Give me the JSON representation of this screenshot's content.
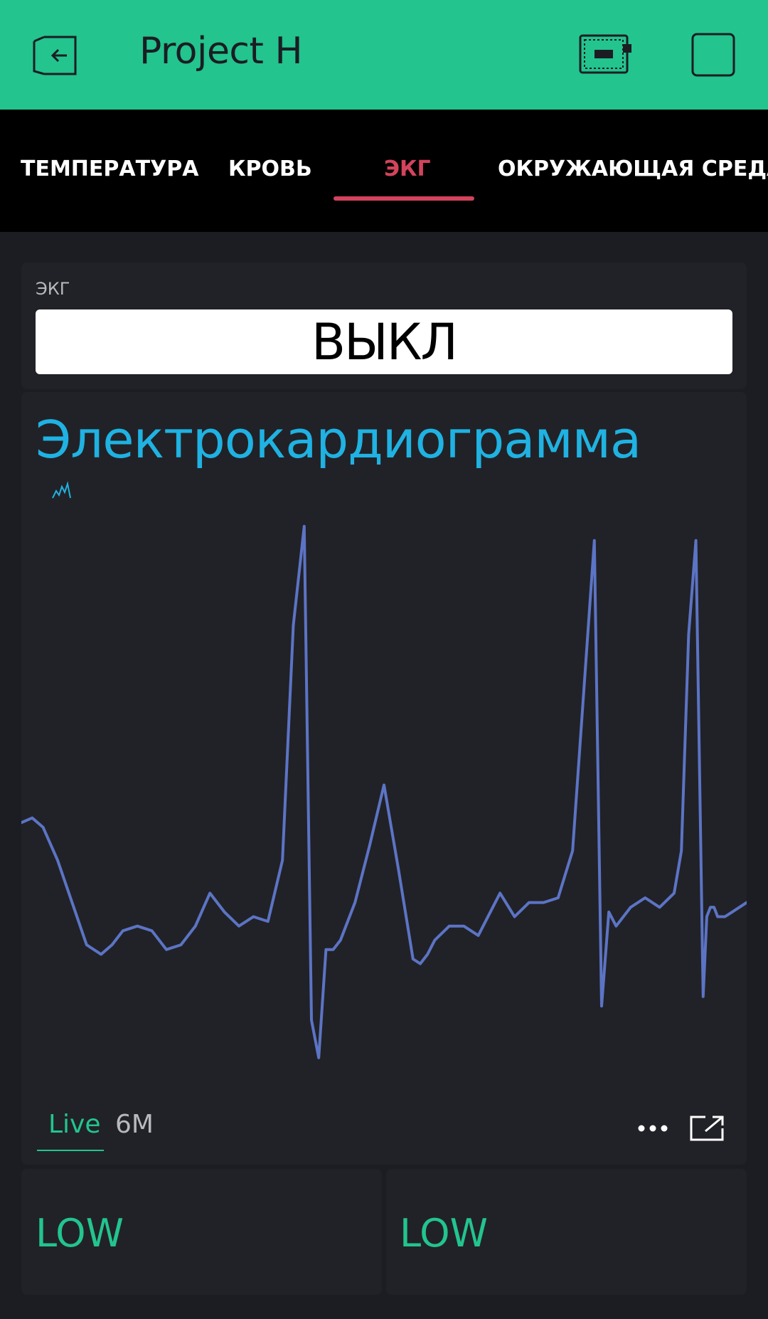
{
  "header": {
    "title": "Project H",
    "background": "#23c48e",
    "icons": [
      "exit-icon",
      "device-board-icon",
      "square-icon"
    ]
  },
  "tabs": [
    {
      "label": "ТЕМПЕРАТУРА",
      "active": false
    },
    {
      "label": "КРОВЬ",
      "active": false
    },
    {
      "label": "ЭКГ",
      "active": true
    },
    {
      "label": "ОКРУЖАЮЩАЯ СРЕДА",
      "active": false
    }
  ],
  "ekg_switch": {
    "label": "ЭКГ",
    "state": "ВЫКЛ"
  },
  "chart": {
    "title": "Электрокардиограмма",
    "title_color": "#1fb2e2",
    "line_color": "#5c74c5",
    "periods": [
      {
        "label": "Live",
        "active": true
      },
      {
        "label": "6M",
        "active": false
      }
    ]
  },
  "chart_data": {
    "type": "line",
    "title": "Электрокардиограмма",
    "xlabel": "",
    "ylabel": "",
    "grid": false,
    "note_units": "relative amplitude (no axis shown), x = sample index 0-100",
    "x": [
      0,
      1.5,
      3,
      5,
      7,
      9,
      11,
      12.5,
      14,
      16,
      18,
      20,
      22,
      24,
      26,
      28,
      30,
      32,
      34,
      36,
      37.5,
      39,
      40,
      41,
      42,
      43,
      44,
      46,
      48,
      50,
      52,
      54,
      55,
      56,
      57,
      59,
      61,
      62,
      63,
      64,
      66,
      68,
      70,
      72,
      74,
      76,
      78,
      79,
      80,
      81,
      82,
      84,
      86,
      88,
      90,
      91,
      92,
      93,
      94,
      94.5,
      95,
      95.5,
      96,
      97,
      98,
      100
    ],
    "y": [
      0.2,
      0.3,
      0.1,
      -0.6,
      -1.5,
      -2.4,
      -2.6,
      -2.4,
      -2.1,
      -2.0,
      -2.1,
      -2.5,
      -2.4,
      -2.0,
      -1.3,
      -1.7,
      -2.0,
      -1.8,
      -1.9,
      -0.6,
      4.4,
      6.5,
      -4.0,
      -4.8,
      -2.5,
      -2.5,
      -2.3,
      -1.5,
      -0.3,
      1.0,
      -0.8,
      -2.7,
      -2.8,
      -2.6,
      -2.3,
      -2.0,
      -2.0,
      -2.1,
      -2.2,
      -1.9,
      -1.3,
      -1.8,
      -1.5,
      -1.5,
      -1.4,
      -0.4,
      4.0,
      6.2,
      -3.7,
      -1.7,
      -2.0,
      -1.6,
      -1.4,
      -1.6,
      -1.3,
      -0.4,
      4.2,
      6.2,
      -3.5,
      -1.8,
      -1.6,
      -1.6,
      -1.8,
      -1.8,
      -1.7,
      -1.5
    ]
  },
  "bottom_widgets": [
    {
      "value": "LOW"
    },
    {
      "value": "LOW"
    }
  ],
  "accent_colors": {
    "green": "#23c48e",
    "red": "#d3435c",
    "blue": "#1fb2e2"
  }
}
